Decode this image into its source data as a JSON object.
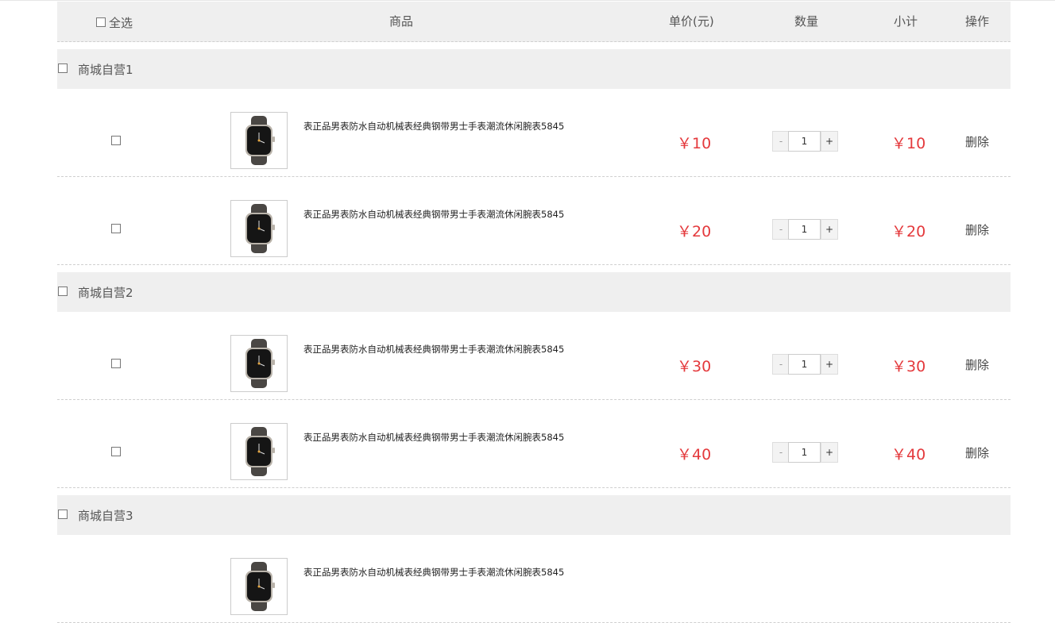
{
  "header": {
    "select_all": "全选",
    "product": "商品",
    "unit_price": "单价(元)",
    "quantity": "数量",
    "subtotal": "小计",
    "action": "操作"
  },
  "colors": {
    "price": "#e4393c",
    "bar": "#efefef"
  },
  "shops": [
    {
      "name": "商城自营1",
      "items": [
        {
          "title": "表正品男表防水自动机械表经典钢带男士手表潮流休闲腕表5845",
          "price": "￥10",
          "qty": "1",
          "subtotal": "￥10",
          "delete": "删除",
          "minus": "-",
          "plus": "+",
          "image": "watch-image"
        },
        {
          "title": "表正品男表防水自动机械表经典钢带男士手表潮流休闲腕表5845",
          "price": "￥20",
          "qty": "1",
          "subtotal": "￥20",
          "delete": "删除",
          "minus": "-",
          "plus": "+",
          "image": "watch-image"
        }
      ]
    },
    {
      "name": "商城自营2",
      "items": [
        {
          "title": "表正品男表防水自动机械表经典钢带男士手表潮流休闲腕表5845",
          "price": "￥30",
          "qty": "1",
          "subtotal": "￥30",
          "delete": "删除",
          "minus": "-",
          "plus": "+",
          "image": "watch-image"
        },
        {
          "title": "表正品男表防水自动机械表经典钢带男士手表潮流休闲腕表5845",
          "price": "￥40",
          "qty": "1",
          "subtotal": "￥40",
          "delete": "删除",
          "minus": "-",
          "plus": "+",
          "image": "watch-image"
        }
      ]
    },
    {
      "name": "商城自营3",
      "items": [
        {
          "title": "表正品男表防水自动机械表经典钢带男士手表潮流休闲腕表5845",
          "image": "watch-image"
        }
      ]
    }
  ]
}
